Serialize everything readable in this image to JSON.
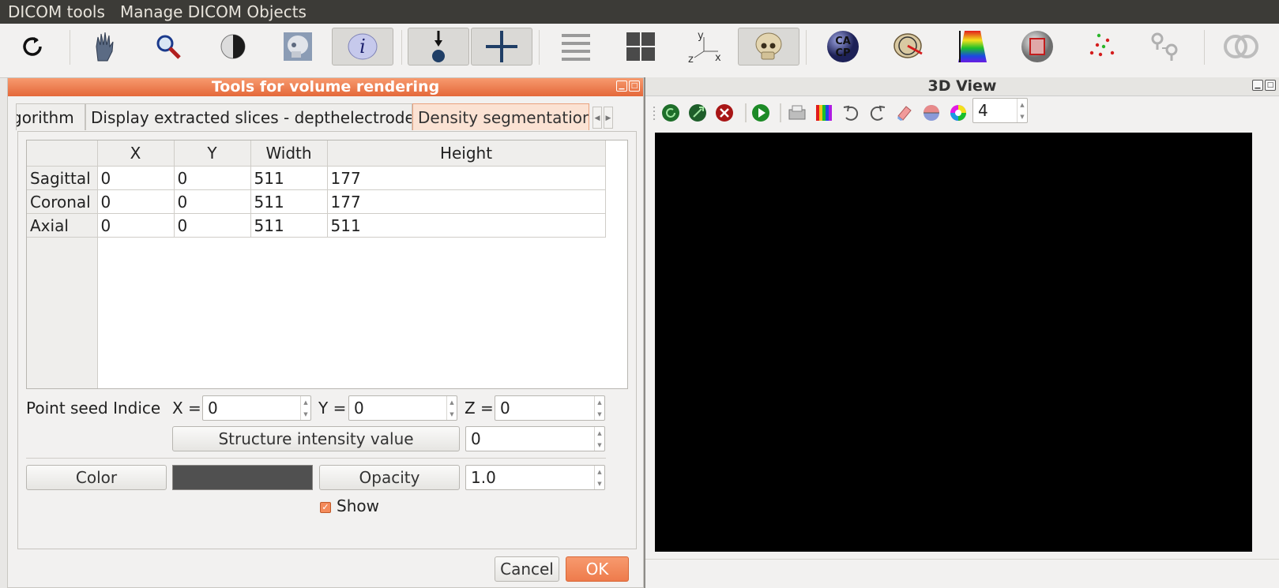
{
  "menubar": {
    "items": [
      {
        "label": "DICOM tools"
      },
      {
        "label": "Manage DICOM Objects"
      }
    ]
  },
  "toolbar": {
    "items": [
      {
        "icon": "refresh-icon"
      },
      {
        "icon": "hand-pan-icon"
      },
      {
        "icon": "magnifier-zoom-icon"
      },
      {
        "icon": "contrast-icon"
      },
      {
        "icon": "skull-xray-icon"
      },
      {
        "icon": "info-icon",
        "label": "i"
      },
      {
        "icon": "probe-point-icon"
      },
      {
        "icon": "crosshair-icon"
      },
      {
        "icon": "slices-stack-icon"
      },
      {
        "icon": "grid-layout-icon"
      },
      {
        "icon": "axes-xyz-icon",
        "axis_labels": [
          "y",
          "z",
          "x"
        ]
      },
      {
        "icon": "skull-3d-icon"
      },
      {
        "icon": "ca-cp-icon",
        "label_top": "CA",
        "label_bottom": "CP"
      },
      {
        "icon": "head-measure-icon"
      },
      {
        "icon": "color-scale-icon"
      },
      {
        "icon": "volume-box-icon"
      },
      {
        "icon": "point-cloud-icon"
      },
      {
        "icon": "electrodes-icon"
      },
      {
        "icon": "rings-icon"
      }
    ]
  },
  "left_panel": {
    "title": "Tools for volume rendering",
    "tabs": [
      {
        "label": "gorithm"
      },
      {
        "label": "Display extracted slices - depthelectrodes"
      },
      {
        "label": "Density segmentation"
      }
    ],
    "table": {
      "columns": [
        "",
        "X",
        "Y",
        "Width",
        "Height"
      ],
      "rows": [
        {
          "name": "Sagittal",
          "x": "0",
          "y": "0",
          "width": "511",
          "height": "177"
        },
        {
          "name": "Coronal",
          "x": "0",
          "y": "0",
          "width": "511",
          "height": "177"
        },
        {
          "name": "Axial",
          "x": "0",
          "y": "0",
          "width": "511",
          "height": "511"
        }
      ]
    },
    "seed": {
      "label": "Point seed Indice",
      "x_label": "X =",
      "x_value": "0",
      "y_label": "Y =",
      "y_value": "0",
      "z_label": "Z =",
      "z_value": "0"
    },
    "structure_intensity": {
      "button_label": "Structure intensity value",
      "value": "0"
    },
    "color": {
      "button_label": "Color",
      "swatch_color": "#505050"
    },
    "opacity": {
      "button_label": "Opacity",
      "value": "1.0"
    },
    "show": {
      "label": "Show",
      "checked": true
    },
    "buttons": {
      "cancel": "Cancel",
      "ok": "OK"
    }
  },
  "right_panel": {
    "title": "3D View",
    "toolbar_icons": [
      "green-refresh-icon",
      "green-rotate-icon",
      "red-close-icon",
      "play-icon",
      "printer-icon",
      "color-bars-icon",
      "undo-icon",
      "redo-icon",
      "eraser-icon",
      "half-sphere-icon",
      "color-wheel-icon"
    ],
    "spin_value": "4",
    "viewport_color": "#000000"
  },
  "colors": {
    "accent": "#ee7b4c",
    "menubar_bg": "#3c3b37",
    "panel_bg": "#f2f1f0"
  }
}
